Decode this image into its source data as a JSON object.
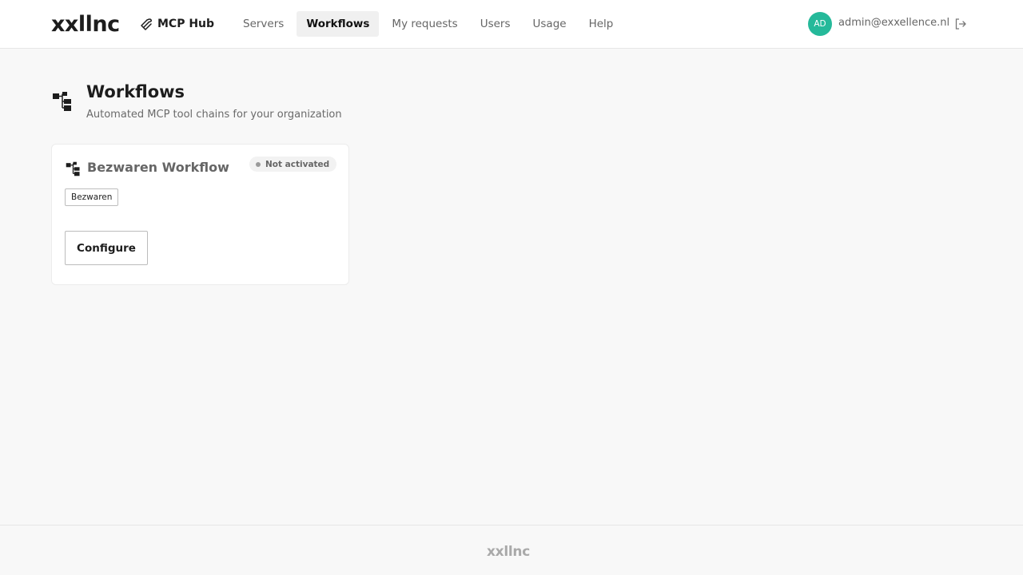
{
  "header": {
    "brand": "xxllnc",
    "product_name": "MCP Hub",
    "nav": [
      {
        "label": "Servers",
        "active": false
      },
      {
        "label": "Workflows",
        "active": true
      },
      {
        "label": "My requests",
        "active": false
      },
      {
        "label": "Users",
        "active": false
      },
      {
        "label": "Usage",
        "active": false
      },
      {
        "label": "Help",
        "active": false
      }
    ],
    "user": {
      "initials": "AD",
      "email": "admin@exxellence.nl",
      "avatar_color": "#25b99a"
    }
  },
  "page": {
    "title": "Workflows",
    "subtitle": "Automated MCP tool chains for your organization",
    "icon": "workflow-icon"
  },
  "workflows": [
    {
      "title": "Bezwaren Workflow",
      "status": "Not activated",
      "tag": "Bezwaren",
      "action_label": "Configure"
    }
  ],
  "footer": {
    "brand": "xxllnc"
  }
}
